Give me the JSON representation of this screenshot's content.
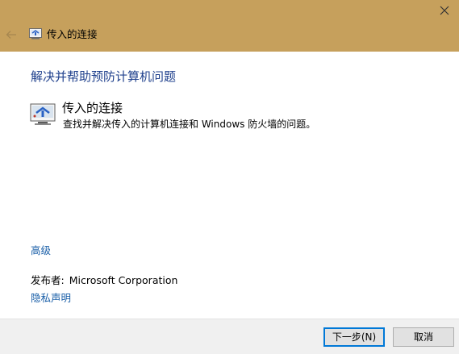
{
  "window": {
    "title": "传入的连接",
    "close_icon": "close-icon",
    "back_icon": "back-arrow-icon",
    "titlebar_color": "#c6a05c"
  },
  "main": {
    "heading": "解决并帮助预防计算机问题",
    "item": {
      "icon": "network-troubleshooter-icon",
      "title": "传入的连接",
      "description": "查找并解决传入的计算机连接和 Windows 防火墙的问题。"
    },
    "advanced_link": "高级",
    "publisher_label": "发布者:",
    "publisher_value": "Microsoft Corporation",
    "privacy_link": "隐私声明"
  },
  "footer": {
    "next_label": "下一步(N)",
    "cancel_label": "取消"
  },
  "colors": {
    "link": "#1a5fa8",
    "heading": "#1e3f8c",
    "accent_border": "#0078d7"
  }
}
